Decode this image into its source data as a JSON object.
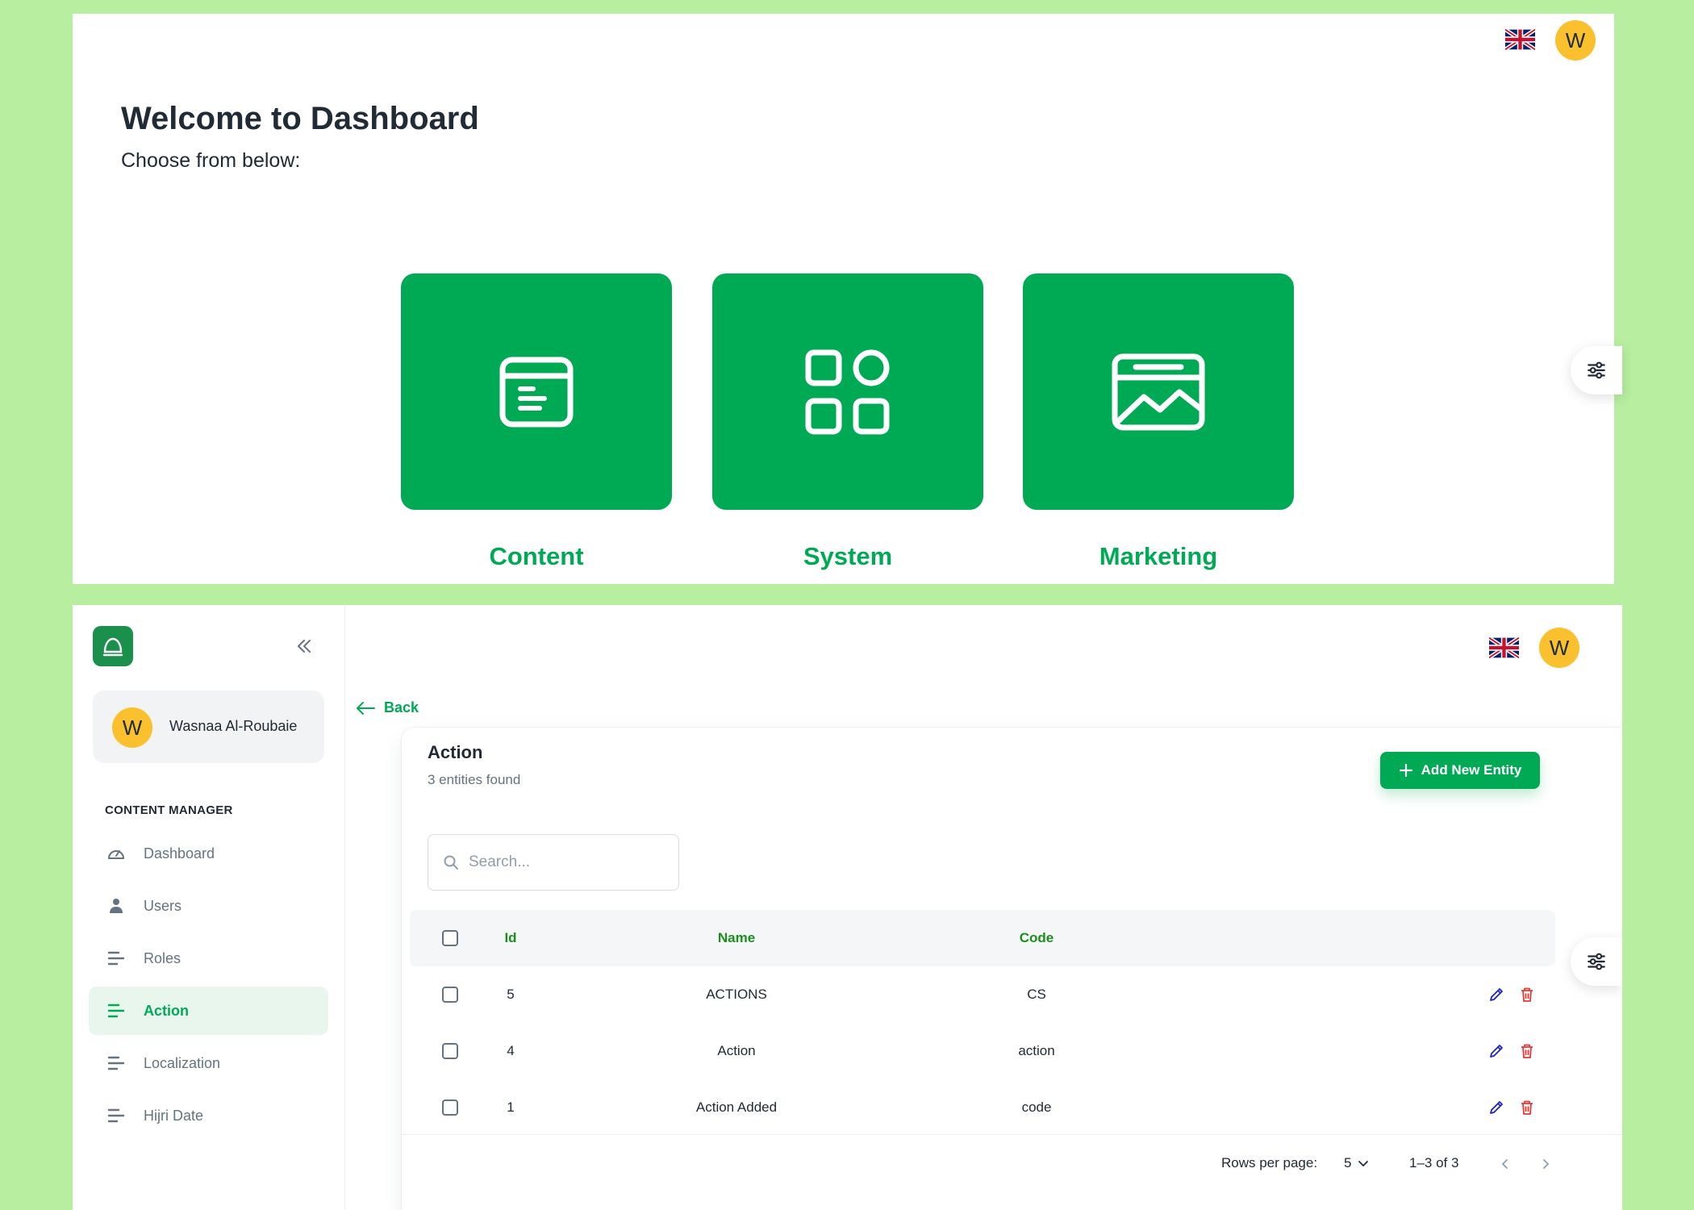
{
  "dashboard": {
    "title": "Welcome to Dashboard",
    "subtitle": "Choose from below:",
    "avatar_letter": "W",
    "language_icon": "uk-flag-icon",
    "tiles": [
      {
        "label": "Content",
        "icon": "content-document-icon"
      },
      {
        "label": "System",
        "icon": "apps-grid-icon"
      },
      {
        "label": "Marketing",
        "icon": "marketing-chart-icon"
      }
    ]
  },
  "sidebar": {
    "user_name": "Wasnaa Al-Roubaie",
    "avatar_letter": "W",
    "section_title": "CONTENT MANAGER",
    "items": [
      {
        "label": "Dashboard",
        "icon": "speedometer-icon",
        "active": false
      },
      {
        "label": "Users",
        "icon": "user-icon",
        "active": false
      },
      {
        "label": "Roles",
        "icon": "lines-icon",
        "active": false
      },
      {
        "label": "Action",
        "icon": "lines-icon",
        "active": true
      },
      {
        "label": "Localization",
        "icon": "lines-icon",
        "active": false
      },
      {
        "label": "Hijri Date",
        "icon": "lines-icon",
        "active": false
      }
    ]
  },
  "header": {
    "avatar_letter": "W",
    "language_icon": "uk-flag-icon"
  },
  "main": {
    "back_label": "Back",
    "card_title": "Action",
    "card_subtitle": "3 entities found",
    "add_button": "Add New Entity",
    "search_placeholder": "Search...",
    "table": {
      "columns": [
        "Id",
        "Name",
        "Code"
      ],
      "rows": [
        {
          "id": "5",
          "name": "ACTIONS",
          "code": "CS"
        },
        {
          "id": "4",
          "name": "Action",
          "code": "action"
        },
        {
          "id": "1",
          "name": "Action Added",
          "code": "code"
        }
      ]
    },
    "pagination": {
      "rows_per_page_label": "Rows per page:",
      "rows_per_page_value": "5",
      "range": "1–3 of 3"
    }
  },
  "colors": {
    "background": "#b7ee9f",
    "primary": "#00aa55",
    "avatar": "#fbc02d",
    "edit_icon": "#1e22c8",
    "delete_icon": "#e53935"
  }
}
